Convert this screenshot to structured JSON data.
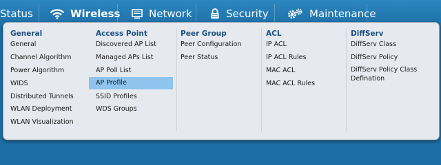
{
  "nav": {
    "items": [
      {
        "label": "Status",
        "icon": "status-icon"
      },
      {
        "label": "Wireless",
        "icon": "wifi-icon",
        "active": true
      },
      {
        "label": "Network",
        "icon": "monitor-icon"
      },
      {
        "label": "Security",
        "icon": "lock-icon"
      },
      {
        "label": "Maintenance",
        "icon": "gears-icon"
      }
    ]
  },
  "dropdown": {
    "columns": [
      {
        "header": "General",
        "items": [
          "General",
          "Channel Algorithm",
          "Power Algorithm",
          "WIDS",
          "Distributed Tunnels",
          "WLAN Deployment",
          "WLAN Visualization"
        ]
      },
      {
        "header": "Access Point",
        "items": [
          "Discovered AP List",
          "Managed APs List",
          "AP Poll List",
          "AP Profile",
          "SSID Profiles",
          "WDS Groups"
        ],
        "selected": "AP Profile"
      },
      {
        "header": "Peer Group",
        "items": [
          "Peer Configuration",
          "Peer Status"
        ]
      },
      {
        "header": "ACL",
        "items": [
          "IP ACL",
          "IP ACL Rules",
          "MAC ACL",
          "MAC ACL Rules"
        ]
      },
      {
        "header": "DiffServ",
        "items": [
          "DiffServ Class",
          "DiffServ Policy",
          "DiffServ Policy Class Defination"
        ]
      }
    ]
  },
  "colors": {
    "nav_bg": "#1b6fa6",
    "header_text": "#1b4f80",
    "selected_bg": "#8ec4ee",
    "panel_bg": "#e6e9ee"
  }
}
